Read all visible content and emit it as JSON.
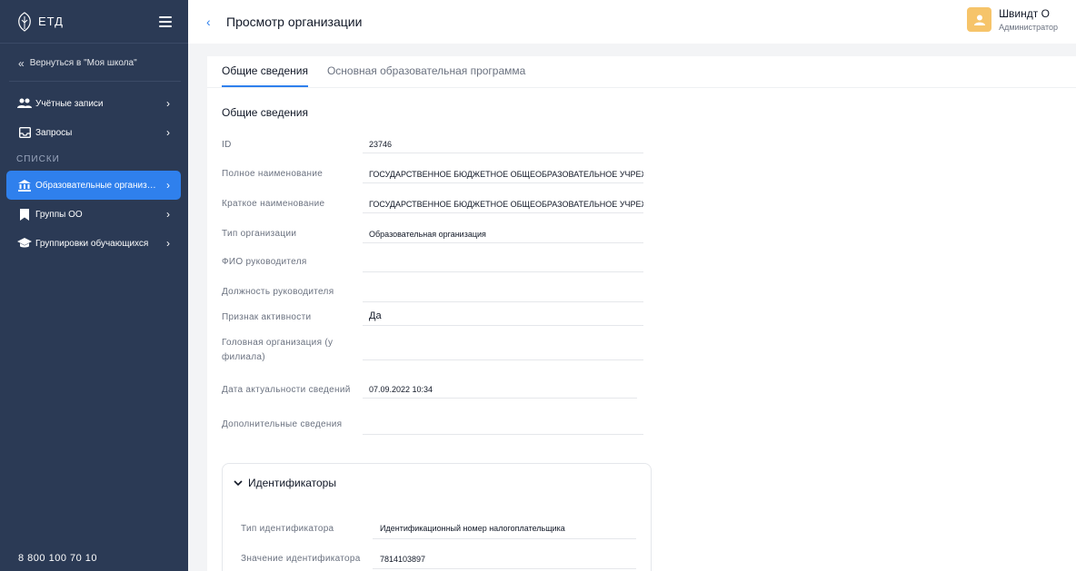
{
  "app": {
    "logo_text": "ЕТД"
  },
  "sidebar": {
    "back_label": "Вернуться в \"Моя школа\"",
    "items_top": [
      {
        "label": "Учётные записи",
        "icon": "users-icon"
      },
      {
        "label": "Запросы",
        "icon": "inbox-icon"
      }
    ],
    "section_label": "СПИСКИ",
    "items_lists": [
      {
        "label": "Образовательные организации",
        "icon": "bank-icon",
        "active": true
      },
      {
        "label": "Группы ОО",
        "icon": "bookmark-icon"
      },
      {
        "label": "Группировки обучающихся",
        "icon": "graduation-cap-icon"
      }
    ],
    "phone": "8 800 100 70 10"
  },
  "header": {
    "title": "Просмотр организации",
    "user_name": "Швиндт О",
    "user_role": "Администратор"
  },
  "tabs": [
    {
      "label": "Общие сведения",
      "active": true
    },
    {
      "label": "Основная образовательная программа",
      "active": false
    }
  ],
  "general": {
    "section_title": "Общие сведения",
    "fields": [
      {
        "label": "ID",
        "value": "23746"
      },
      {
        "label": "Полное наименование",
        "value": "ГОСУДАРСТВЕННОЕ БЮДЖЕТНОЕ ОБЩЕОБРАЗОВАТЕЛЬНОЕ УЧРЕЖДЕНИЕ"
      },
      {
        "label": "Краткое наименование",
        "value": "ГОСУДАРСТВЕННОЕ БЮДЖЕТНОЕ ОБЩЕОБРАЗОВАТЕЛЬНОЕ УЧРЕЖДЕНИЕ"
      },
      {
        "label": "Тип организации",
        "value": "Образовательная организация"
      },
      {
        "label": "ФИО руководителя",
        "value": ""
      },
      {
        "label": "Должность руководителя",
        "value": ""
      },
      {
        "label": "Признак активности",
        "value": "Да"
      },
      {
        "label": "Головная организация (у филиала)",
        "value": ""
      },
      {
        "label": "Дата актуальности сведений",
        "value": "07.09.2022 10:34"
      },
      {
        "label": "Дополнительные сведения",
        "value": ""
      }
    ]
  },
  "identifiers": {
    "title": "Идентификаторы",
    "rows": [
      {
        "label": "Тип идентификатора",
        "value": "Идентификационный номер налогоплательщика"
      },
      {
        "label": "Значение идентификатора",
        "value": "7814103897"
      }
    ]
  },
  "colors": {
    "sidebar_bg": "#2b3a55",
    "accent": "#2f80ed",
    "avatar_bg": "#f6c46a"
  }
}
